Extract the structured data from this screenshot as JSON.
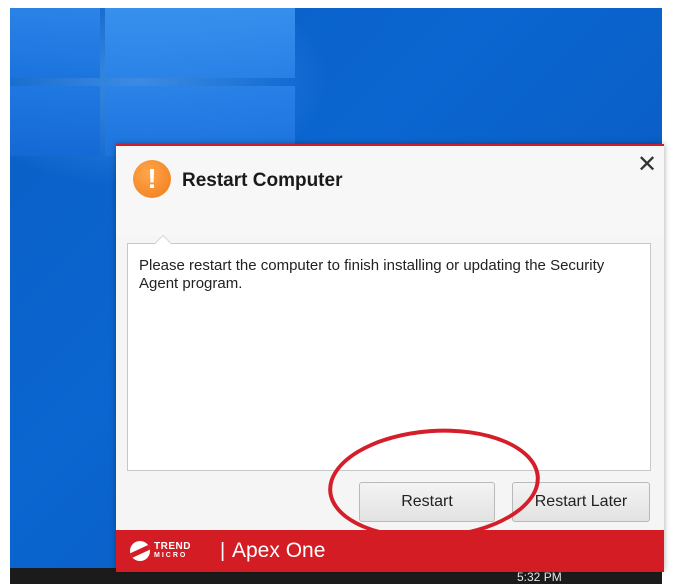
{
  "dialog": {
    "title": "Restart Computer",
    "icon": "warning-icon",
    "icon_glyph": "!",
    "close_glyph": "✕",
    "message": "Please restart the computer to finish installing or updating the Security Agent program.",
    "buttons": {
      "restart_label": "Restart",
      "restart_later_label": "Restart Later"
    },
    "footer": {
      "brand_top": "TREND",
      "brand_bottom": "MICRO",
      "separator": "|",
      "product": "Apex One"
    }
  },
  "taskbar": {
    "time": "5:32 PM"
  },
  "colors": {
    "accent_red": "#d31c24",
    "warning_orange": "#f07c18",
    "desktop_blue": "#0b66d1"
  }
}
